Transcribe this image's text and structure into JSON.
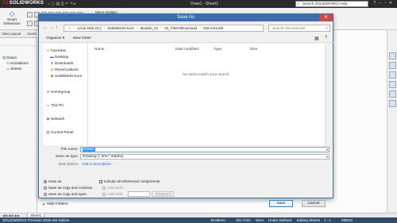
{
  "app": {
    "logo_text": "SOLIDWORKS",
    "document_title": "Draw1 - Sheet1",
    "search_placeholder": "Search SOLIDWORKS Help",
    "command_manager": {
      "smart_dimension_line1": "Smart",
      "smart_dimension_line2": "Dimension",
      "mirror_entities": "Mirror Entities"
    },
    "tabs": [
      "View Layout",
      "Annot"
    ],
    "tree": {
      "root": "Draw1",
      "annotations": "Annotations",
      "sheet": "Sheet1"
    },
    "sheet_tab": "Sheet1",
    "status": {
      "edition": "SOLIDWORKS Premium 2015 x64 Edition",
      "x": "36.86mm",
      "y": "281.7mm",
      "z": "0mm",
      "state": "Under Defined",
      "editing": "Editing Sheet1",
      "scale": "1 : 1",
      "units": "MMGS"
    }
  },
  "dialog": {
    "title": "Save As",
    "close_label": "✕",
    "address": {
      "crumbs": [
        "Local Disk (D:)",
        "SolidWorks-kurs",
        "Module_01",
        "02_FilesHDownload",
        "SW-m01v05"
      ],
      "search_placeholder": "Search SW-m01v05"
    },
    "command_bar": {
      "organize": "Organize",
      "new_folder": "New folder"
    },
    "nav": {
      "favorites": "Favorites",
      "desktop": "Desktop",
      "downloads": "Downloads",
      "recent_places": "Recent places",
      "solidworks_kurs": "SolidWorks-kurs",
      "homegroup": "Homegroup",
      "this_pc": "This PC",
      "network": "Network",
      "control_panel": "Control Panel"
    },
    "columns": {
      "name": "Name",
      "date_modified": "Date modified",
      "type": "Type",
      "size": "Size"
    },
    "empty_message": "No items match your search.",
    "form": {
      "file_name_label": "File name:",
      "file_name_value": "Draw1",
      "save_as_type_label": "Save as type:",
      "save_as_type_value": "Drawing (*.drw;*.slddrw)",
      "description_label": "Description:",
      "description_link": "Add a description"
    },
    "options": {
      "save_as": "Save as",
      "save_as_copy_continue": "Save as copy and continue",
      "save_as_copy_open": "Save as copy and open",
      "include_refs": "Include all referenced components",
      "add_prefix": "Add prefix",
      "add_suffix": "Add suffix",
      "advanced": "Advanced"
    },
    "hide_folders": "Hide Folders",
    "save_button": "Save",
    "cancel_button": "Cancel"
  },
  "colors": {
    "dialog_title_bar": "#3d6ea7",
    "status_bar": "#2e4a6d",
    "selection": "#3399ff",
    "link": "#2c6ac0"
  }
}
